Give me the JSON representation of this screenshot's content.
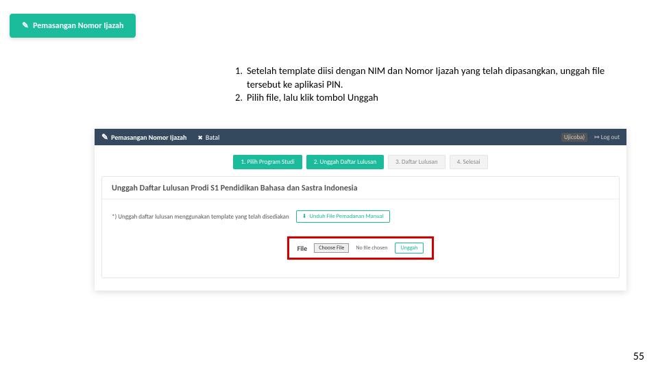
{
  "badge": {
    "label": "Pemasangan Nomor Ijazah"
  },
  "instructions": {
    "items": [
      "Setelah template diisi dengan NIM dan Nomor Ijazah yang telah dipasangkan, unggah file tersebut ke aplikasi PIN.",
      "Pilih file, lalu klik tombol Unggah"
    ]
  },
  "topbar": {
    "crumb": "Pemasangan Nomor Ijazah",
    "batal": "Batal",
    "user_tag": "Ujicoba)",
    "logout": "Log out"
  },
  "steps": [
    {
      "label": "1. Pilih Program Studi",
      "active": true
    },
    {
      "label": "2. Unggah Daftar Lulusan",
      "active": true
    },
    {
      "label": "3. Daftar Lulusan",
      "active": false
    },
    {
      "label": "4. Selesai",
      "active": false
    }
  ],
  "panel": {
    "title": "Unggah Daftar Lulusan Prodi S1 Pendidikan Bahasa dan Sastra Indonesia",
    "note": "*) Unggah daftar lulusan menggunakan template yang telah disediakan",
    "download_btn": "Unduh File Pemadanan Manual"
  },
  "file_row": {
    "label": "File",
    "choose": "Choose File",
    "nofile": "No file chosen",
    "upload": "Unggah"
  },
  "page_number": "55"
}
